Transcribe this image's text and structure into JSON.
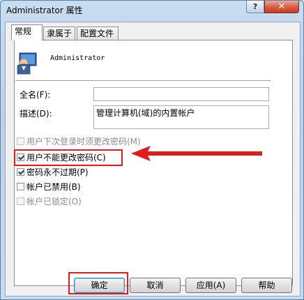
{
  "window": {
    "title": "Administrator 属性",
    "help_label": "?",
    "close_label": "✕"
  },
  "tabs": [
    {
      "label": "常规"
    },
    {
      "label": "隶属于"
    },
    {
      "label": "配置文件"
    }
  ],
  "user": {
    "name": "Administrator",
    "icon": "user-avatar-icon"
  },
  "fields": {
    "fullname_label": "全名(F):",
    "fullname_value": "",
    "desc_label": "描述(D):",
    "desc_value": "管理计算机(域)的内置帐户"
  },
  "options": [
    {
      "label": "用户下次登录时须更改密码(M)",
      "checked": false,
      "disabled": true
    },
    {
      "label": "用户不能更改密码(C)",
      "checked": true,
      "disabled": false
    },
    {
      "label": "密码永不过期(P)",
      "checked": true,
      "disabled": false
    },
    {
      "label": "帐户已禁用(B)",
      "checked": false,
      "disabled": false
    },
    {
      "label": "帐户已锁定(O)",
      "checked": false,
      "disabled": true
    }
  ],
  "buttons": {
    "ok": "确定",
    "cancel": "取消",
    "apply": "应用(A)",
    "help": "帮助"
  },
  "colors": {
    "highlight": "#e41b1b",
    "accent": "#3c7fb1"
  }
}
